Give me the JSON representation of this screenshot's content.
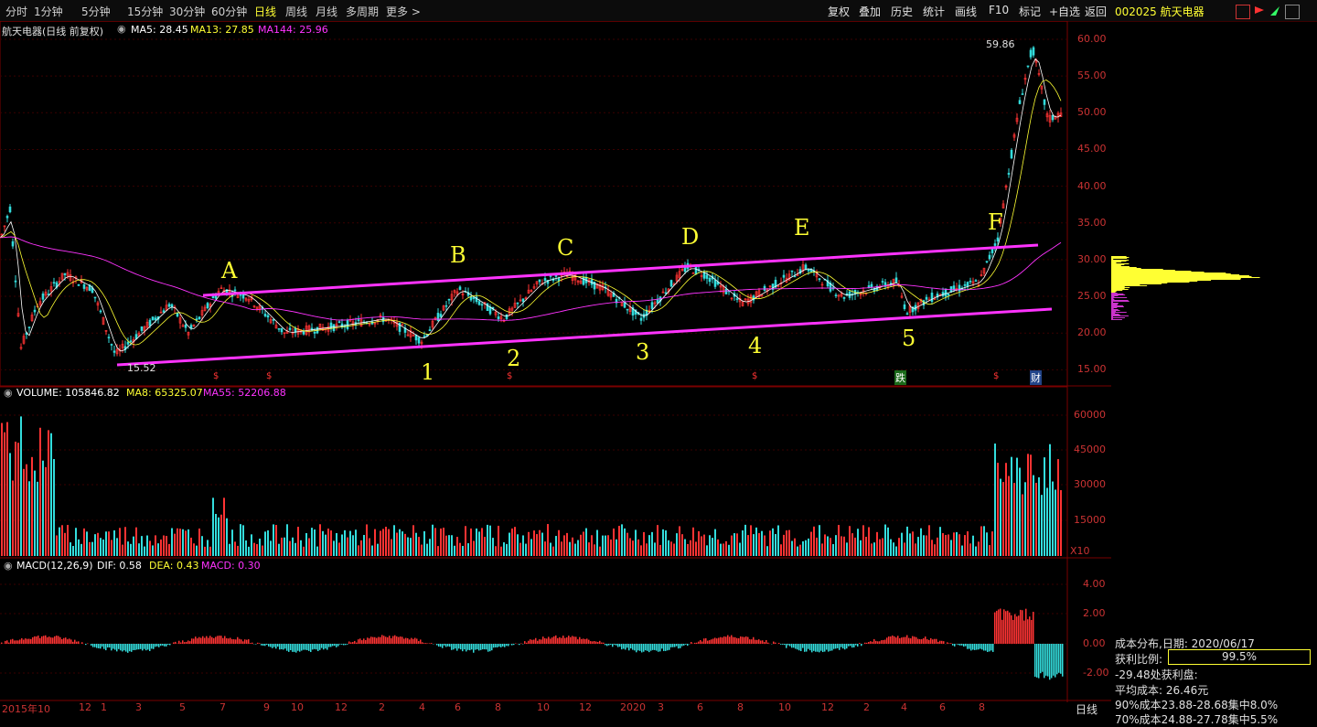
{
  "toolbar": {
    "periods": [
      "分时",
      "1分钟",
      "5分钟",
      "15分钟",
      "30分钟",
      "60分钟",
      "日线",
      "周线",
      "月线",
      "多周期",
      "更多 >"
    ],
    "active_period": "日线",
    "right_items": [
      "复权",
      "叠加",
      "历史",
      "统计",
      "画线",
      "F10",
      "标记",
      "+自选",
      "返回"
    ]
  },
  "stock": {
    "code_name": "002025 航天电器",
    "chart_title": "航天电器(日线 前复权)"
  },
  "main_legend": {
    "ma5": "MA5: 28.45",
    "ma13": "MA13: 27.85",
    "ma144": "MA144: 25.96",
    "colors": {
      "ma5": "#ffffff",
      "ma13": "#ffff33",
      "ma144": "#ff33ff"
    }
  },
  "main_annotations": {
    "high_label": "59.86",
    "low_label": "15.52",
    "markers": [
      "跌",
      "财"
    ]
  },
  "volume_legend": {
    "volume": "VOLUME: 105846.82",
    "ma8": "MA8: 65325.07",
    "ma55": "MA55: 52206.88"
  },
  "macd_legend": {
    "macd_title": "MACD(12,26,9)",
    "dif": "DIF: 0.58",
    "dea": "DEA: 0.43",
    "macd": "MACD: 0.30"
  },
  "price_axis": [
    "60.00",
    "55.00",
    "50.00",
    "45.00",
    "40.00",
    "35.00",
    "30.00",
    "25.00",
    "20.00",
    "15.00"
  ],
  "volume_axis": [
    "60000",
    "45000",
    "30000",
    "15000"
  ],
  "volume_unit": "X10",
  "macd_axis": [
    "4.00",
    "2.00",
    "0.00",
    "-2.00"
  ],
  "x_axis": [
    "2015年10",
    "12",
    "1",
    "3",
    "5",
    "7",
    "9",
    "10",
    "12",
    "2",
    "4",
    "6",
    "8",
    "10",
    "12",
    "2020",
    "3",
    "6",
    "8",
    "10",
    "12",
    "2",
    "4",
    "6",
    "8"
  ],
  "footer_label": "日线",
  "wave_labels": {
    "upper": [
      "A",
      "B",
      "C",
      "D",
      "E",
      "F"
    ],
    "lower": [
      "1",
      "2",
      "3",
      "4",
      "5"
    ]
  },
  "cost_panel": {
    "title": "成本分布,日期: 2020/06/17",
    "profit_label": "获利比例:",
    "profit_value": "99.5%",
    "profit_fraction": 0.995,
    "profit_line": "-29.48处获利盘:",
    "avg_cost": "平均成本: 26.46元",
    "concentration90": "90%成本23.88-28.68集中8.0%",
    "concentration70": "70%成本24.88-27.78集中5.5%"
  }
}
